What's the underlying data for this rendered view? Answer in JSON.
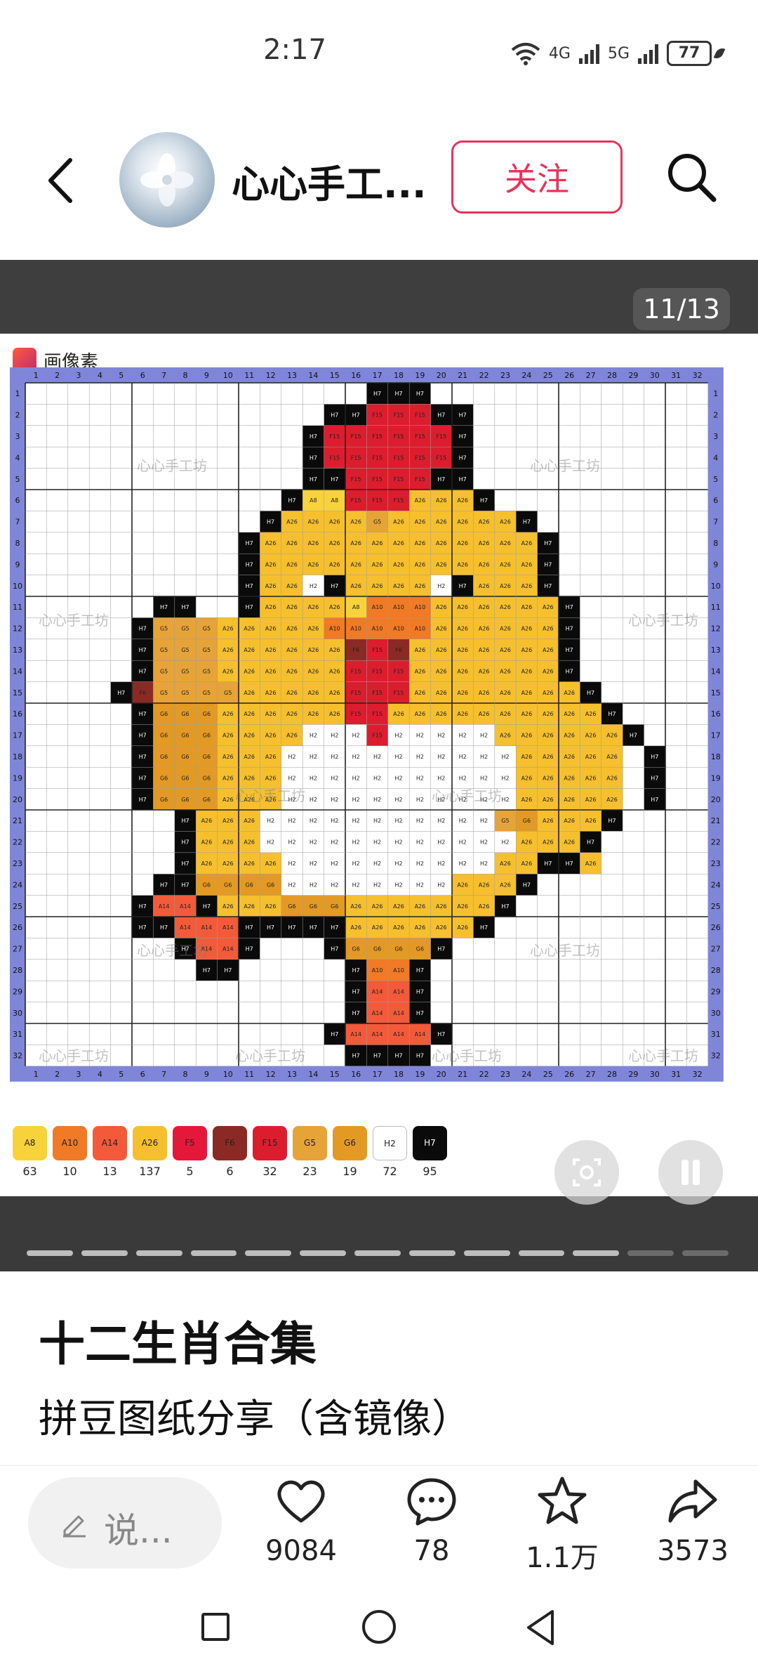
{
  "status_bar": {
    "time": "2:17",
    "network1": "4G",
    "network2": "5G",
    "battery": "77"
  },
  "header": {
    "author_name": "心心手工...",
    "follow_label": "关注"
  },
  "viewer": {
    "page_counter": "11/13",
    "app_name": "画像素",
    "watermark": "心心手工坊",
    "grid_columns": [
      "1",
      "2",
      "3",
      "4",
      "5",
      "6",
      "7",
      "8",
      "9",
      "10",
      "11",
      "12",
      "13",
      "14",
      "15",
      "16",
      "17",
      "18",
      "19",
      "20",
      "21",
      "22",
      "23",
      "24",
      "25",
      "26",
      "27",
      "28",
      "29",
      "30",
      "31",
      "32"
    ],
    "grid_rows": [
      "1",
      "2",
      "3",
      "4",
      "5",
      "6",
      "7",
      "8",
      "9",
      "10",
      "11",
      "12",
      "13",
      "14",
      "15",
      "16",
      "17",
      "18",
      "19",
      "20",
      "21",
      "22",
      "23",
      "24",
      "25",
      "26",
      "27",
      "28",
      "29",
      "30",
      "31",
      "32"
    ],
    "palette": [
      {
        "code": "A8",
        "count": "63",
        "color": "#f8d23a"
      },
      {
        "code": "A10",
        "count": "10",
        "color": "#f07a25"
      },
      {
        "code": "A14",
        "count": "13",
        "color": "#f35a3a"
      },
      {
        "code": "A26",
        "count": "137",
        "color": "#f6bf2e"
      },
      {
        "code": "F5",
        "count": "5",
        "color": "#e5183a"
      },
      {
        "code": "F6",
        "count": "6",
        "color": "#8b2a24"
      },
      {
        "code": "F15",
        "count": "32",
        "color": "#dc1d2e"
      },
      {
        "code": "G5",
        "count": "23",
        "color": "#e6a337"
      },
      {
        "code": "G6",
        "count": "19",
        "color": "#e39a24"
      },
      {
        "code": "H2",
        "count": "72",
        "color": "#ffffff"
      },
      {
        "code": "H7",
        "count": "95",
        "color": "#0a0a0a"
      }
    ],
    "slides_total": 13,
    "slide_current": 11
  },
  "post": {
    "title": "十二生肖合集",
    "subtitle": "拼豆图纸分享（含镜像）"
  },
  "actions": {
    "comment_placeholder": "说...",
    "likes": "9084",
    "comments": "78",
    "favorites": "1.1万",
    "shares": "3573"
  }
}
